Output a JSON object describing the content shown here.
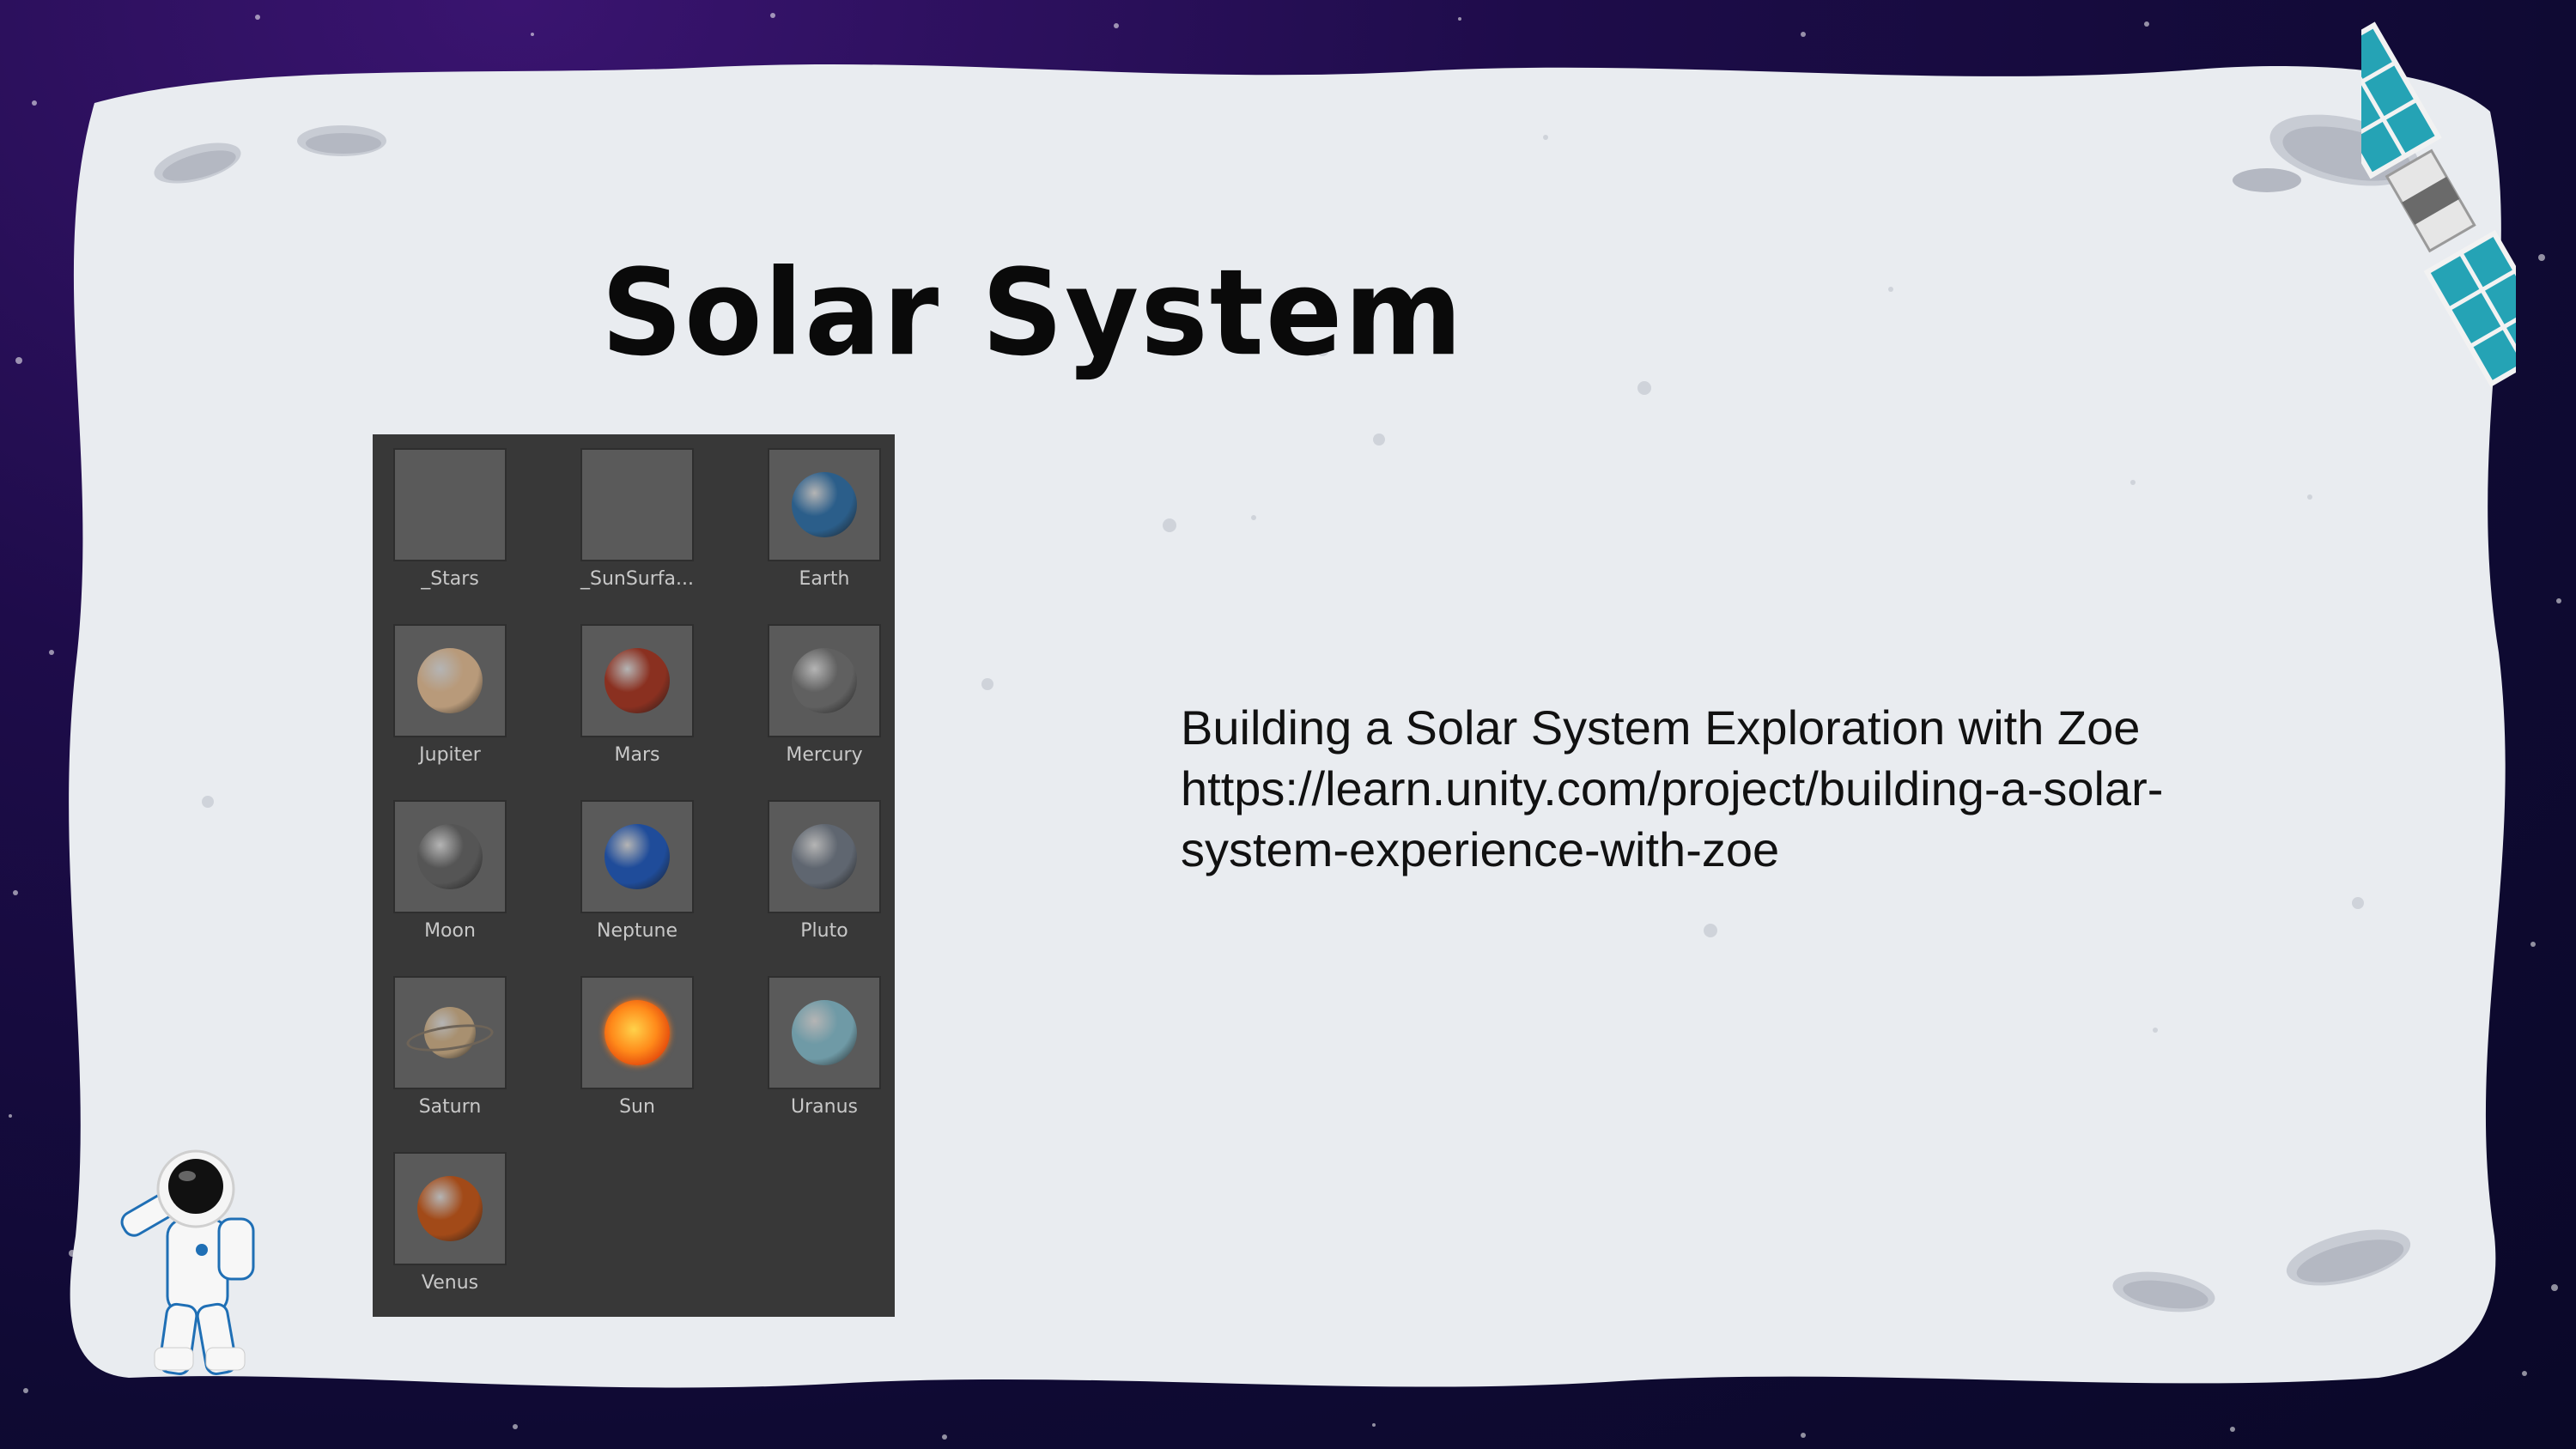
{
  "slide": {
    "title": "Solar System",
    "info_lines": [
      "Building a Solar System Exploration with Zoe",
      "https://learn.unity.com/project/building-a-solar-",
      "system-experience-with-zoe"
    ]
  },
  "assets": {
    "items": [
      {
        "label": "_Stars",
        "icon": "blank-material-icon",
        "color": "#5a5a5a"
      },
      {
        "label": "_SunSurfa...",
        "icon": "blank-material-icon",
        "color": "#5a5a5a"
      },
      {
        "label": "Earth",
        "icon": "earth-icon",
        "color": "#2b5e8a"
      },
      {
        "label": "Jupiter",
        "icon": "jupiter-icon",
        "color": "#b89a7a"
      },
      {
        "label": "Mars",
        "icon": "mars-icon",
        "color": "#8a3020"
      },
      {
        "label": "Mercury",
        "icon": "mercury-icon",
        "color": "#606060"
      },
      {
        "label": "Moon",
        "icon": "moon-icon",
        "color": "#555555"
      },
      {
        "label": "Neptune",
        "icon": "neptune-icon",
        "color": "#1f4c9a"
      },
      {
        "label": "Pluto",
        "icon": "pluto-icon",
        "color": "#5f6670"
      },
      {
        "label": "Saturn",
        "icon": "saturn-icon",
        "color": "#a89070"
      },
      {
        "label": "Sun",
        "icon": "sun-icon",
        "color": "#f05a10"
      },
      {
        "label": "Uranus",
        "icon": "uranus-icon",
        "color": "#6f9aa6"
      },
      {
        "label": "Venus",
        "icon": "venus-icon",
        "color": "#a24a18"
      }
    ]
  },
  "colors": {
    "space_background": "#160d40",
    "card_background": "#e9ecf0",
    "panel_background": "#383838"
  }
}
